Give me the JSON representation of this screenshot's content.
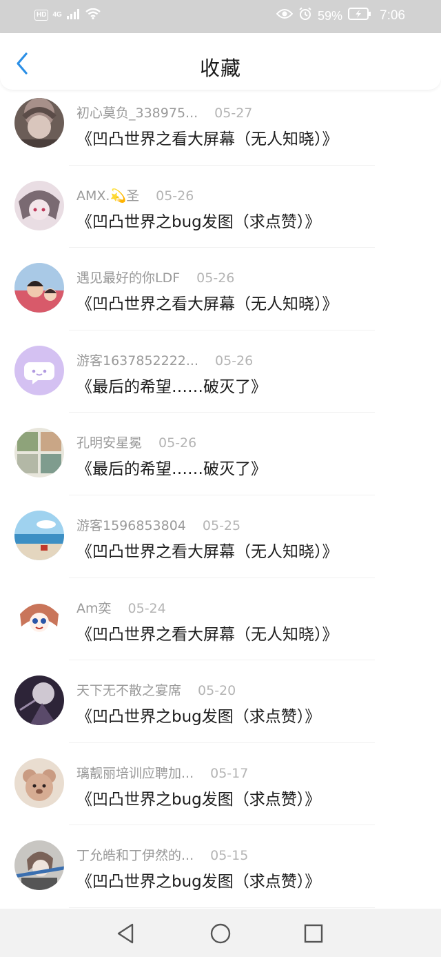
{
  "status_bar": {
    "hd": "HD",
    "network": "4G",
    "battery": "59%",
    "time": "7:06"
  },
  "header": {
    "title": "收藏",
    "back_icon": "chevron-left-icon"
  },
  "items": [
    {
      "user": "初心莫负_338975...",
      "date": "05-27",
      "title": "《凹凸世界之看大屏幕（无人知晓）》"
    },
    {
      "user": "AMX.💫圣",
      "date": "05-26",
      "title": "《凹凸世界之bug发图（求点赞）》"
    },
    {
      "user": "遇见最好的你LDF",
      "date": "05-26",
      "title": "《凹凸世界之看大屏幕（无人知晓）》"
    },
    {
      "user": "游客1637852222...",
      "date": "05-26",
      "title": "《最后的希望……破灭了》"
    },
    {
      "user": "孔明安星冕",
      "date": "05-26",
      "title": "《最后的希望……破灭了》"
    },
    {
      "user": "游客1596853804",
      "date": "05-25",
      "title": "《凹凸世界之看大屏幕（无人知晓）》"
    },
    {
      "user": "Am奕",
      "date": "05-24",
      "title": "《凹凸世界之看大屏幕（无人知晓）》"
    },
    {
      "user": "天下无不散之宴席",
      "date": "05-20",
      "title": "《凹凸世界之bug发图（求点赞）》"
    },
    {
      "user": "璃靓丽培训应聘加...",
      "date": "05-17",
      "title": "《凹凸世界之bug发图（求点赞）》"
    },
    {
      "user": "丁允皓和丁伊然的...",
      "date": "05-15",
      "title": "《凹凸世界之bug发图（求点赞）》"
    }
  ],
  "nav_bar": {
    "back_icon": "triangle-back-icon",
    "home_icon": "circle-home-icon",
    "recents_icon": "square-recents-icon"
  },
  "colors": {
    "accent": "#2b8fe6",
    "status_bar_bg": "#d2d2d2",
    "nav_bar_bg": "#f2f2f2",
    "meta_text": "#9a9a9a",
    "title_text": "#1d1d1d"
  }
}
